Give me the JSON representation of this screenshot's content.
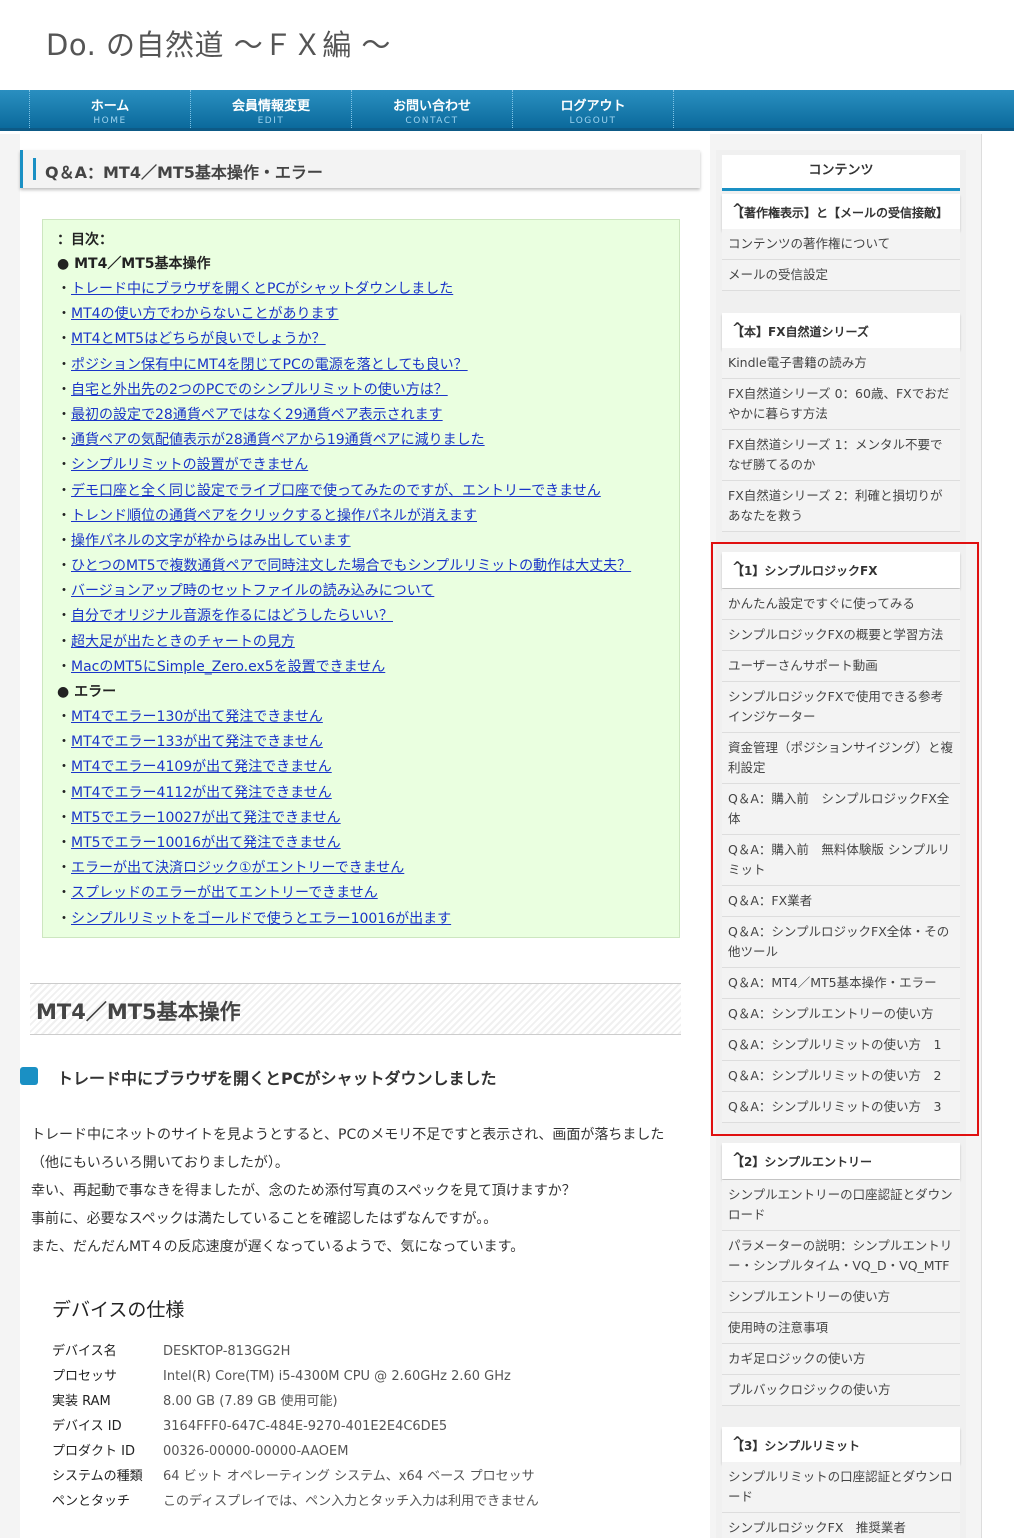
{
  "site": {
    "title": "Do. の自然道 〜ＦＸ編 〜"
  },
  "nav": [
    {
      "jp": "ホーム",
      "en": "HOME"
    },
    {
      "jp": "会員情報変更",
      "en": "EDIT"
    },
    {
      "jp": "お問い合わせ",
      "en": "CONTACT"
    },
    {
      "jp": "ログアウト",
      "en": "LOGOUT"
    }
  ],
  "page": {
    "heading": "Q＆A：MT4／MT5基本操作・エラー"
  },
  "toc": {
    "title": "：目次：",
    "section1": "●  MT4／MT5基本操作",
    "links1": [
      "トレード中にブラウザを開くとPCがシャットダウンしました",
      "MT4の使い方でわからないことがあります",
      "MT4とMT5はどちらが良いでしょうか？",
      "ポジション保有中にMT4を閉じてPCの電源を落としても良い？",
      "自宅と外出先の2つのPCでのシンプルリミットの使い方は？",
      "最初の設定で28通貨ペアではなく29通貨ペア表示されます",
      "通貨ペアの気配値表示が28通貨ペアから19通貨ペアに減りました",
      "シンプルリミットの設置ができません",
      "デモ口座と全く同じ設定でライブ口座で使ってみたのですが、エントリーできません",
      "トレンド順位の通貨ペアをクリックすると操作パネルが消えます",
      "操作パネルの文字が枠からはみ出しています",
      "ひとつのMT5で複数通貨ペアで同時注文した場合でもシンプルリミットの動作は大丈夫？",
      "バージョンアップ時のセットファイルの読み込みについて",
      "自分でオリジナル音源を作るにはどうしたらいい？",
      "超大足が出たときのチャートの見方",
      "MacのMT5にSimple_Zero.ex5を設置できません"
    ],
    "section2": "●  エラー",
    "links2": [
      "MT4でエラー130が出て発注できません",
      "MT4でエラー133が出て発注できません",
      "MT4でエラー4109が出て発注できません",
      "MT4でエラー4112が出て発注できません",
      "MT5でエラー10027が出て発注できません",
      "MT5でエラー10016が出て発注できません",
      "エラーが出て決済ロジック①がエントリーできません",
      "スプレッドのエラーが出てエントリーできません",
      "シンプルリミットをゴールドで使うとエラー10016が出ます"
    ]
  },
  "article": {
    "h2": "MT4／MT5基本操作",
    "h3": "トレード中にブラウザを開くとPCがシャットダウンしました",
    "paragraph": [
      "トレード中にネットのサイトを見ようとすると、PCのメモリ不足ですと表示され、画面が落ちました（他にもいろいろ開いておりましたが）。",
      "幸い、再起動で事なきを得ましたが、念のため添付写真のスペックを見て頂けますか？",
      "事前に、必要なスペックは満たしていることを確認したはずなんですが。。",
      "また、だんだんMT４の反応速度が遅くなっているようで、気になっています。"
    ],
    "device": {
      "title": "デバイスの仕様",
      "rows": [
        {
          "k": "デバイス名",
          "v": "DESKTOP-813GG2H"
        },
        {
          "k": "プロセッサ",
          "v": "Intel(R) Core(TM) i5-4300M CPU @ 2.60GHz   2.60 GHz"
        },
        {
          "k": "実装 RAM",
          "v": "8.00 GB (7.89 GB 使用可能)"
        },
        {
          "k": "デバイス ID",
          "v": "3164FFF0-647C-484E-9270-401E2E4C6DE5"
        },
        {
          "k": "プロダクト ID",
          "v": "00326-00000-00000-AAOEM"
        },
        {
          "k": "システムの種類",
          "v": "64 ビット オペレーティング システム、x64 ベース プロセッサ"
        },
        {
          "k": "ペンとタッチ",
          "v": "このディスプレイでは、ペン入力とタッチ入力は利用できません"
        }
      ]
    }
  },
  "sidebar": {
    "title": "コンテンツ",
    "chevron": "^",
    "groups": [
      {
        "head": "【著作権表示】と【メールの受信接敵】",
        "items": [
          "コンテンツの著作権について",
          "メールの受信設定"
        ]
      },
      {
        "head": "【本】FX自然道シリーズ",
        "items": [
          "Kindle電子書籍の読み方",
          "FX自然道シリーズ 0：60歳、FXでおだやかに暮らす方法",
          "FX自然道シリーズ 1：メンタル不要でなぜ勝てるのか",
          "FX自然道シリーズ 2：利確と損切りがあなたを救う"
        ]
      },
      {
        "head": "【1】シンプルロジックFX",
        "items": [
          "かんたん設定ですぐに使ってみる",
          "シンプルロジックFXの概要と学習方法",
          "ユーザーさんサポート動画",
          "シンプルロジックFXで使用できる参考インジケーター",
          "資金管理（ポジションサイジング）と複利設定",
          "Q＆A：購入前　シンプルロジックFX全体",
          "Q＆A：購入前　無料体験版 シンプルリミット",
          "Q＆A：FX業者",
          "Q＆A：シンプルロジックFX全体・その他ツール",
          "Q＆A：MT4／MT5基本操作・エラー",
          "Q＆A：シンプルエントリーの使い方",
          "Q＆A：シンプルリミットの使い方　1",
          "Q＆A：シンプルリミットの使い方　2",
          "Q＆A：シンプルリミットの使い方　3"
        ]
      },
      {
        "head": "【2】シンプルエントリー",
        "items": [
          "シンプルエントリーの口座認証とダウンロード",
          "パラメーターの説明：シンプルエントリー・シンプルタイム・VQ_D・VQ_MTF",
          "シンプルエントリーの使い方",
          "使用時の注意事項",
          "カギ足ロジックの使い方",
          "プルバックロジックの使い方"
        ]
      },
      {
        "head": "【3】シンプルリミット",
        "items": [
          "シンプルリミットの口座認証とダウンロード",
          "シンプルロジックFX　推奨業者"
        ]
      }
    ]
  }
}
